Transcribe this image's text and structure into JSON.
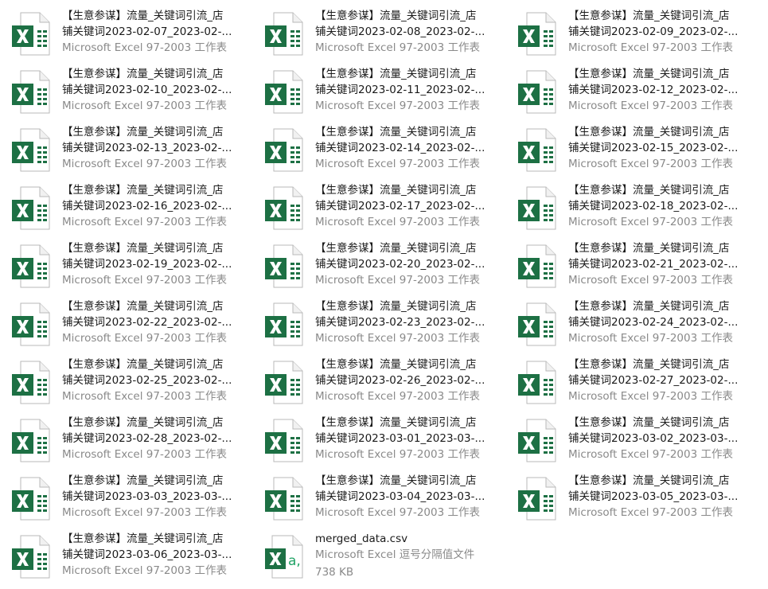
{
  "files": [
    {
      "line1": "【生意参谋】流量_关键词引流_店",
      "line2": "铺关键词2023-02-07_2023-02-...",
      "line3": "Microsoft Excel 97-2003 工作表",
      "icon": "excel-xls-icon"
    },
    {
      "line1": "【生意参谋】流量_关键词引流_店",
      "line2": "铺关键词2023-02-08_2023-02-...",
      "line3": "Microsoft Excel 97-2003 工作表",
      "icon": "excel-xls-icon"
    },
    {
      "line1": "【生意参谋】流量_关键词引流_店",
      "line2": "铺关键词2023-02-09_2023-02-...",
      "line3": "Microsoft Excel 97-2003 工作表",
      "icon": "excel-xls-icon"
    },
    {
      "line1": "【生意参谋】流量_关键词引流_店",
      "line2": "铺关键词2023-02-10_2023-02-...",
      "line3": "Microsoft Excel 97-2003 工作表",
      "icon": "excel-xls-icon"
    },
    {
      "line1": "【生意参谋】流量_关键词引流_店",
      "line2": "铺关键词2023-02-11_2023-02-...",
      "line3": "Microsoft Excel 97-2003 工作表",
      "icon": "excel-xls-icon"
    },
    {
      "line1": "【生意参谋】流量_关键词引流_店",
      "line2": "铺关键词2023-02-12_2023-02-...",
      "line3": "Microsoft Excel 97-2003 工作表",
      "icon": "excel-xls-icon"
    },
    {
      "line1": "【生意参谋】流量_关键词引流_店",
      "line2": "铺关键词2023-02-13_2023-02-...",
      "line3": "Microsoft Excel 97-2003 工作表",
      "icon": "excel-xls-icon"
    },
    {
      "line1": "【生意参谋】流量_关键词引流_店",
      "line2": "铺关键词2023-02-14_2023-02-...",
      "line3": "Microsoft Excel 97-2003 工作表",
      "icon": "excel-xls-icon"
    },
    {
      "line1": "【生意参谋】流量_关键词引流_店",
      "line2": "铺关键词2023-02-15_2023-02-...",
      "line3": "Microsoft Excel 97-2003 工作表",
      "icon": "excel-xls-icon"
    },
    {
      "line1": "【生意参谋】流量_关键词引流_店",
      "line2": "铺关键词2023-02-16_2023-02-...",
      "line3": "Microsoft Excel 97-2003 工作表",
      "icon": "excel-xls-icon"
    },
    {
      "line1": "【生意参谋】流量_关键词引流_店",
      "line2": "铺关键词2023-02-17_2023-02-...",
      "line3": "Microsoft Excel 97-2003 工作表",
      "icon": "excel-xls-icon"
    },
    {
      "line1": "【生意参谋】流量_关键词引流_店",
      "line2": "铺关键词2023-02-18_2023-02-...",
      "line3": "Microsoft Excel 97-2003 工作表",
      "icon": "excel-xls-icon"
    },
    {
      "line1": "【生意参谋】流量_关键词引流_店",
      "line2": "铺关键词2023-02-19_2023-02-...",
      "line3": "Microsoft Excel 97-2003 工作表",
      "icon": "excel-xls-icon"
    },
    {
      "line1": "【生意参谋】流量_关键词引流_店",
      "line2": "铺关键词2023-02-20_2023-02-...",
      "line3": "Microsoft Excel 97-2003 工作表",
      "icon": "excel-xls-icon"
    },
    {
      "line1": "【生意参谋】流量_关键词引流_店",
      "line2": "铺关键词2023-02-21_2023-02-...",
      "line3": "Microsoft Excel 97-2003 工作表",
      "icon": "excel-xls-icon"
    },
    {
      "line1": "【生意参谋】流量_关键词引流_店",
      "line2": "铺关键词2023-02-22_2023-02-...",
      "line3": "Microsoft Excel 97-2003 工作表",
      "icon": "excel-xls-icon"
    },
    {
      "line1": "【生意参谋】流量_关键词引流_店",
      "line2": "铺关键词2023-02-23_2023-02-...",
      "line3": "Microsoft Excel 97-2003 工作表",
      "icon": "excel-xls-icon"
    },
    {
      "line1": "【生意参谋】流量_关键词引流_店",
      "line2": "铺关键词2023-02-24_2023-02-...",
      "line3": "Microsoft Excel 97-2003 工作表",
      "icon": "excel-xls-icon"
    },
    {
      "line1": "【生意参谋】流量_关键词引流_店",
      "line2": "铺关键词2023-02-25_2023-02-...",
      "line3": "Microsoft Excel 97-2003 工作表",
      "icon": "excel-xls-icon"
    },
    {
      "line1": "【生意参谋】流量_关键词引流_店",
      "line2": "铺关键词2023-02-26_2023-02-...",
      "line3": "Microsoft Excel 97-2003 工作表",
      "icon": "excel-xls-icon"
    },
    {
      "line1": "【生意参谋】流量_关键词引流_店",
      "line2": "铺关键词2023-02-27_2023-02-...",
      "line3": "Microsoft Excel 97-2003 工作表",
      "icon": "excel-xls-icon"
    },
    {
      "line1": "【生意参谋】流量_关键词引流_店",
      "line2": "铺关键词2023-02-28_2023-02-...",
      "line3": "Microsoft Excel 97-2003 工作表",
      "icon": "excel-xls-icon"
    },
    {
      "line1": "【生意参谋】流量_关键词引流_店",
      "line2": "铺关键词2023-03-01_2023-03-...",
      "line3": "Microsoft Excel 97-2003 工作表",
      "icon": "excel-xls-icon"
    },
    {
      "line1": "【生意参谋】流量_关键词引流_店",
      "line2": "铺关键词2023-03-02_2023-03-...",
      "line3": "Microsoft Excel 97-2003 工作表",
      "icon": "excel-xls-icon"
    },
    {
      "line1": "【生意参谋】流量_关键词引流_店",
      "line2": "铺关键词2023-03-03_2023-03-...",
      "line3": "Microsoft Excel 97-2003 工作表",
      "icon": "excel-xls-icon"
    },
    {
      "line1": "【生意参谋】流量_关键词引流_店",
      "line2": "铺关键词2023-03-04_2023-03-...",
      "line3": "Microsoft Excel 97-2003 工作表",
      "icon": "excel-xls-icon"
    },
    {
      "line1": "【生意参谋】流量_关键词引流_店",
      "line2": "铺关键词2023-03-05_2023-03-...",
      "line3": "Microsoft Excel 97-2003 工作表",
      "icon": "excel-xls-icon"
    },
    {
      "line1": "【生意参谋】流量_关键词引流_店",
      "line2": "铺关键词2023-03-06_2023-03-...",
      "line3": "Microsoft Excel 97-2003 工作表",
      "icon": "excel-xls-icon"
    },
    {
      "line1": "merged_data.csv",
      "line2": "Microsoft Excel 逗号分隔值文件",
      "line3": "738 KB",
      "icon": "excel-csv-icon"
    }
  ],
  "colors": {
    "excel_green": "#1d7044",
    "excel_green_light": "#21a366",
    "name_text": "#1a1a1a",
    "sub_text": "#8a8a8a"
  }
}
